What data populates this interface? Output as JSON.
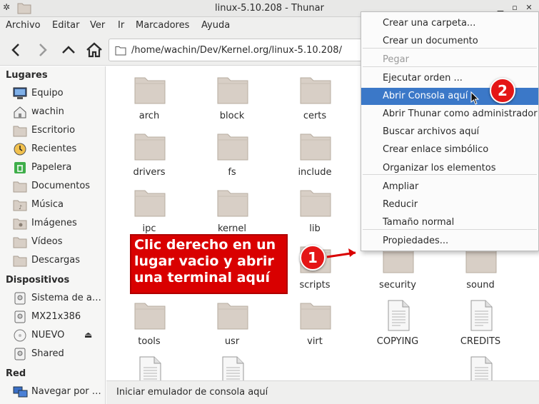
{
  "window": {
    "title": "linux-5.10.208 - Thunar"
  },
  "menubar": [
    "Archivo",
    "Editar",
    "Ver",
    "Ir",
    "Marcadores",
    "Ayuda"
  ],
  "toolbar": {
    "path": "/home/wachin/Dev/Kernel.org/linux-5.10.208/"
  },
  "sidebar": {
    "places_heading": "Lugares",
    "places": [
      "Equipo",
      "wachin",
      "Escritorio",
      "Recientes",
      "Papelera",
      "Documentos",
      "Música",
      "Imágenes",
      "Vídeos",
      "Descargas"
    ],
    "devices_heading": "Dispositivos",
    "devices": [
      "Sistema de a…",
      "MX21x386",
      "NUEVO",
      "Shared"
    ],
    "network_heading": "Red",
    "network": [
      "Navegar por …"
    ]
  },
  "files": [
    {
      "name": "arch",
      "type": "folder"
    },
    {
      "name": "block",
      "type": "folder"
    },
    {
      "name": "certs",
      "type": "folder"
    },
    {
      "name": "drivers",
      "type": "folder"
    },
    {
      "name": "fs",
      "type": "folder"
    },
    {
      "name": "include",
      "type": "folder"
    },
    {
      "name": "ipc",
      "type": "folder"
    },
    {
      "name": "kernel",
      "type": "folder"
    },
    {
      "name": "lib",
      "type": "folder"
    },
    {
      "name": "scripts",
      "type": "folder"
    },
    {
      "name": "security",
      "type": "folder"
    },
    {
      "name": "sound",
      "type": "folder"
    },
    {
      "name": "tools",
      "type": "folder"
    },
    {
      "name": "usr",
      "type": "folder"
    },
    {
      "name": "virt",
      "type": "folder"
    },
    {
      "name": "COPYING",
      "type": "file"
    },
    {
      "name": "CREDITS",
      "type": "file"
    }
  ],
  "statusbar": {
    "text": "Iniciar emulador de consola aquí"
  },
  "context_menu": {
    "items": [
      {
        "label": "Crear una carpeta..."
      },
      {
        "label": "Crear un documento"
      },
      {
        "label": "Pegar",
        "disabled": true
      },
      {
        "label": "Ejecutar orden ..."
      },
      {
        "label": "Abrir Consola aquí",
        "highlighted": true
      },
      {
        "label": "Abrir Thunar como administrador"
      },
      {
        "label": "Buscar archivos aquí"
      },
      {
        "label": "Crear enlace simbólico"
      },
      {
        "label": "Organizar los elementos"
      },
      {
        "label": "Ampliar"
      },
      {
        "label": "Reducir"
      },
      {
        "label": "Tamaño normal"
      },
      {
        "label": "Propiedades..."
      }
    ]
  },
  "annotations": {
    "callout_text": "Clic derecho en un lugar vacio y abrir una terminal aquí",
    "badge1": "1",
    "badge2": "2"
  },
  "colors": {
    "highlight": "#3b78c8",
    "annotation_red": "#d90000",
    "folder": "#d8cfc6"
  }
}
